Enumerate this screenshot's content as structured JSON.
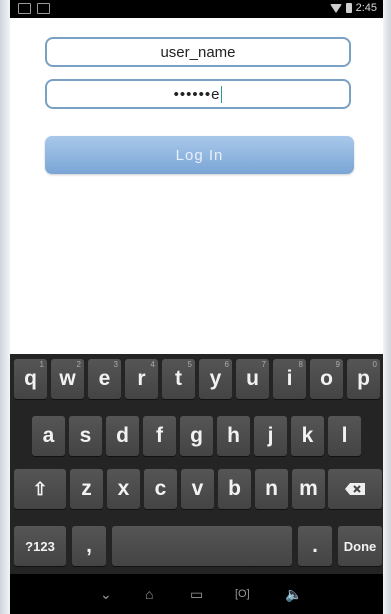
{
  "status_bar": {
    "time": "2:45"
  },
  "login_form": {
    "username_value": "user_name",
    "password_masked": "••••••",
    "password_last_char": "e",
    "login_label": "Log  In"
  },
  "keyboard": {
    "row1": [
      {
        "ch": "q",
        "num": "1"
      },
      {
        "ch": "w",
        "num": "2"
      },
      {
        "ch": "e",
        "num": "3"
      },
      {
        "ch": "r",
        "num": "4"
      },
      {
        "ch": "t",
        "num": "5"
      },
      {
        "ch": "y",
        "num": "6"
      },
      {
        "ch": "u",
        "num": "7"
      },
      {
        "ch": "i",
        "num": "8"
      },
      {
        "ch": "o",
        "num": "9"
      },
      {
        "ch": "p",
        "num": "0"
      }
    ],
    "row2": [
      "a",
      "s",
      "d",
      "f",
      "g",
      "h",
      "j",
      "k",
      "l"
    ],
    "row3": [
      "z",
      "x",
      "c",
      "v",
      "b",
      "n",
      "m"
    ],
    "symbols_label": "?123",
    "comma_label": ",",
    "period_label": ".",
    "done_label": "Done"
  },
  "nav": {
    "recents_label": "[O]"
  }
}
